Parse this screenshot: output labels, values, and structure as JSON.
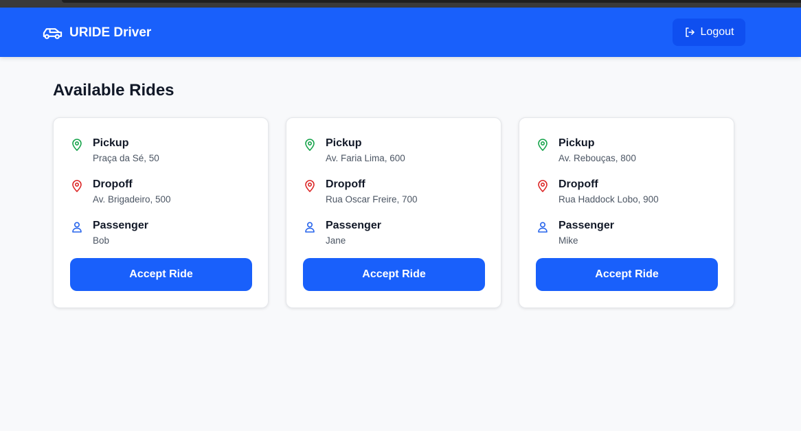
{
  "app": {
    "title": "URIDE Driver",
    "logo_icon": "car-icon"
  },
  "header": {
    "logout_label": "Logout",
    "logout_icon": "logout-icon",
    "color": "#1960fb"
  },
  "main": {
    "title": "Available Rides",
    "rides": [
      {
        "pickup_label": "Pickup",
        "pickup": "Praça da Sé, 50",
        "dropoff_label": "Dropoff",
        "dropoff": "Av. Brigadeiro, 500",
        "passenger_label": "Passenger",
        "passenger": "Bob",
        "accept_label": "Accept Ride"
      },
      {
        "pickup_label": "Pickup",
        "pickup": "Av. Faria Lima, 600",
        "dropoff_label": "Dropoff",
        "dropoff": "Rua Oscar Freire, 700",
        "passenger_label": "Passenger",
        "passenger": "Jane",
        "accept_label": "Accept Ride"
      },
      {
        "pickup_label": "Pickup",
        "pickup": "Av. Rebouças, 800",
        "dropoff_label": "Dropoff",
        "dropoff": "Rua Haddock Lobo, 900",
        "passenger_label": "Passenger",
        "passenger": "Mike",
        "accept_label": "Accept Ride"
      }
    ]
  },
  "colors": {
    "primary": "#1960fb",
    "pickup_icon": "#16a34a",
    "dropoff_icon": "#dc2626",
    "passenger_icon": "#2563eb"
  }
}
